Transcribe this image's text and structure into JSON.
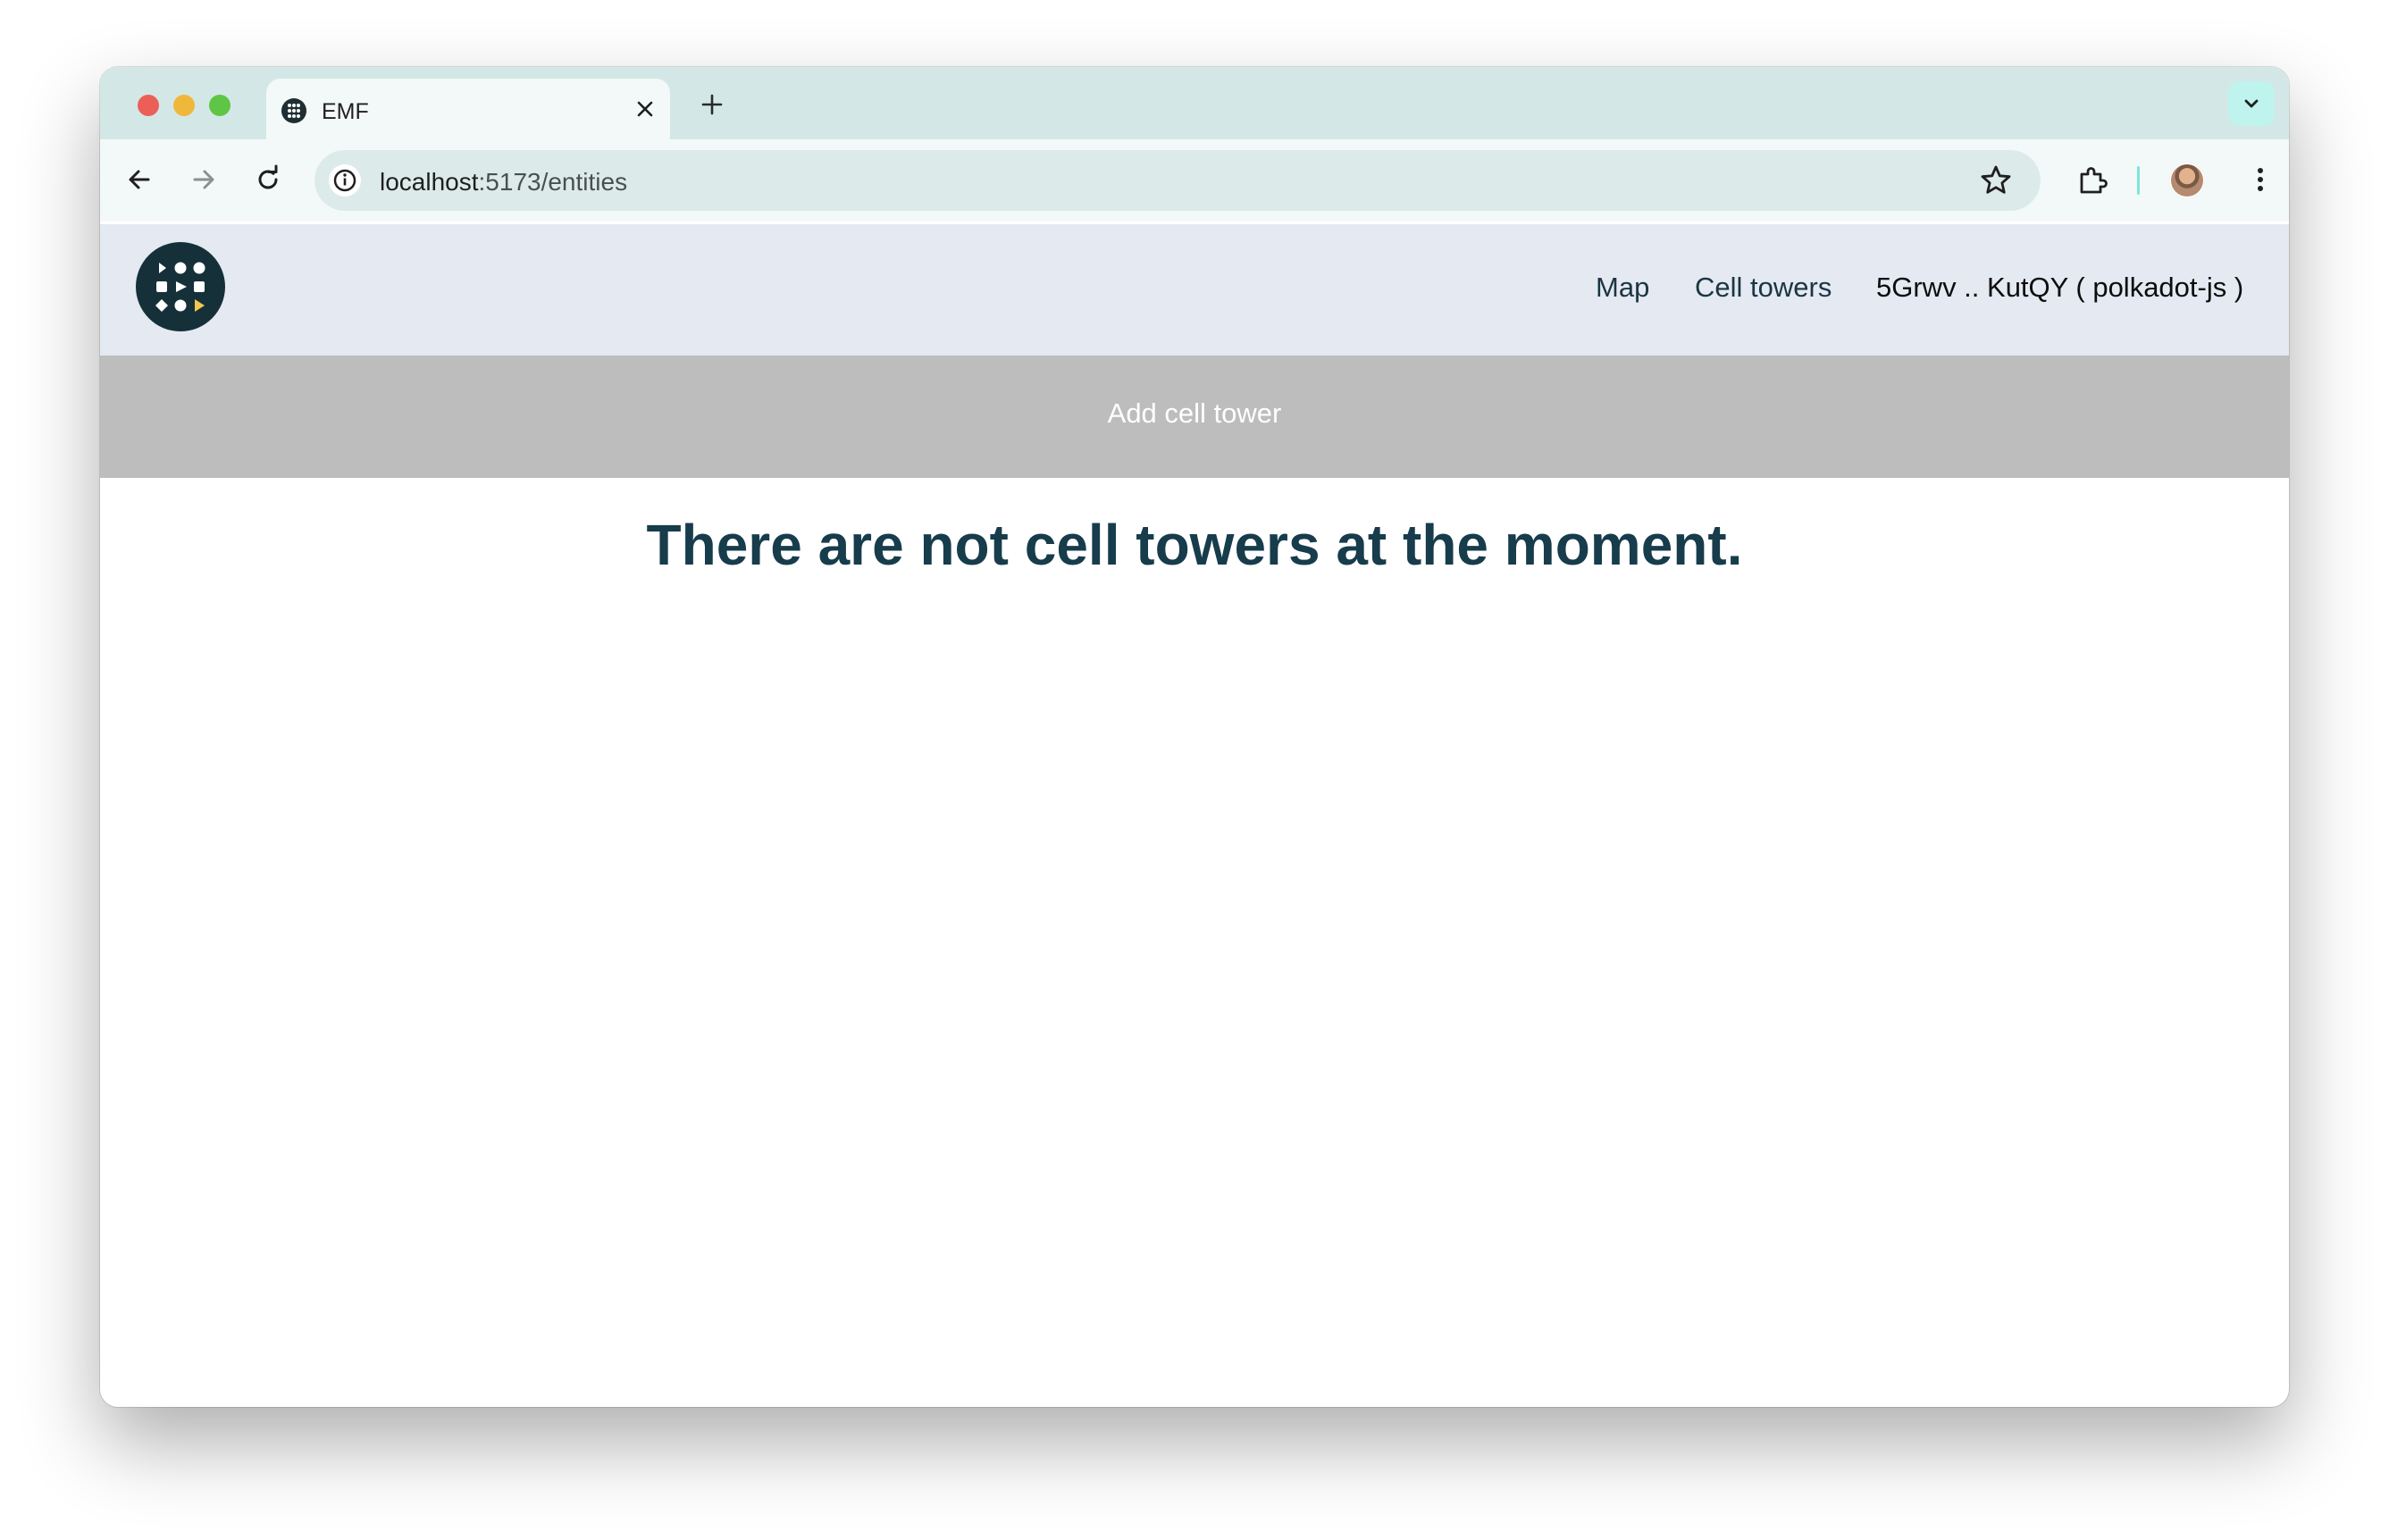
{
  "browser": {
    "tab": {
      "title": "EMF"
    },
    "address": {
      "host": "localhost",
      "path": ":5173/entities"
    }
  },
  "app": {
    "nav": {
      "map": "Map",
      "cell_towers": "Cell towers",
      "account": "5Grwv .. KutQY  ( polkadot-js )"
    },
    "add_button": "Add cell tower",
    "empty_message": "There are not cell towers at the moment."
  },
  "colors": {
    "header_bg": "#e4e9f2",
    "add_bar_bg": "#bdbdbd",
    "heading": "#173c4c",
    "logo_bg": "#16303a",
    "logo_accent": "#f2c94c"
  }
}
